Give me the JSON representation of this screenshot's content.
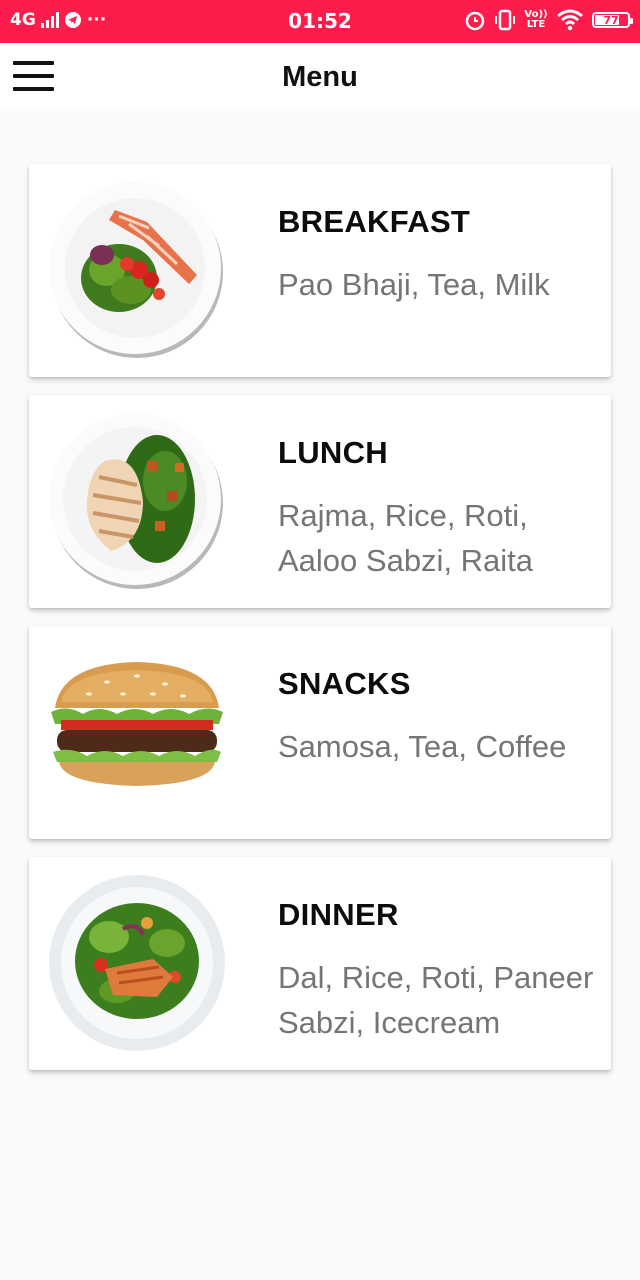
{
  "status_bar": {
    "network": "4G",
    "more": "···",
    "time": "01:52",
    "volte": "Vo)) LTE",
    "battery": "77",
    "battery_level": 0.77
  },
  "app_bar": {
    "menu_icon": "hamburger-menu-icon",
    "title": "Menu"
  },
  "meals": [
    {
      "title": "BREAKFAST",
      "items": "Pao Bhaji, Tea, Milk",
      "image": "salmon-salad-plate-image"
    },
    {
      "title": "LUNCH",
      "items": "Rajma, Rice, Roti, Aaloo Sabzi, Raita",
      "image": "chicken-salad-plate-image"
    },
    {
      "title": "SNACKS",
      "items": "Samosa, Tea, Coffee",
      "image": "burger-image"
    },
    {
      "title": "DINNER",
      "items": "Dal, Rice, Roti, Paneer Sabzi, Icecream",
      "image": "salmon-salad-bowl-image"
    }
  ],
  "colors": {
    "status_bar": "#fe1c4d",
    "title_text": "#0c0c0c",
    "items_text": "#757575",
    "background": "#fafafa"
  }
}
